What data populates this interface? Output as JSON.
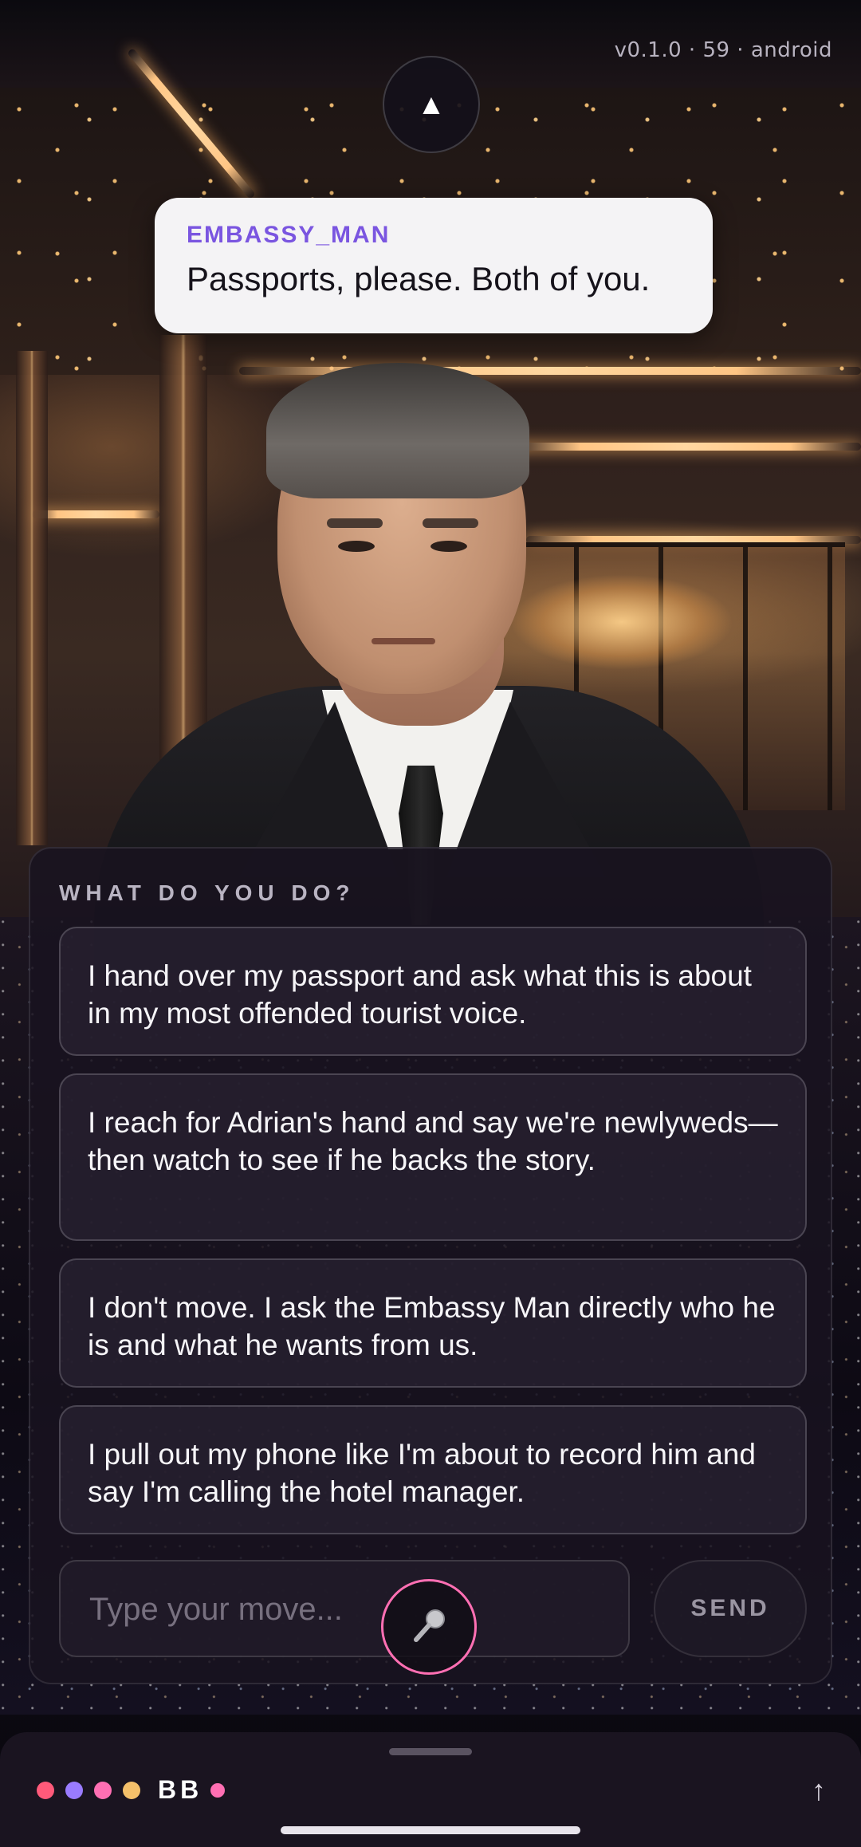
{
  "status": {
    "version": "v0.1.0 · 59 · android"
  },
  "collapse_button": {
    "glyph": "▲"
  },
  "dialogue": {
    "speaker": "EMBASSY_MAN",
    "line": "Passports, please. Both of you."
  },
  "choices_panel": {
    "prompt": "WHAT DO YOU DO?",
    "choices": [
      "I hand over my passport and ask what this is about in my most offended tourist voice.",
      "I reach for Adrian's hand and say we're newlyweds—then watch to see if he backs the story.",
      "I don't move. I ask the Embassy Man directly who he is and what he wants from us.",
      "I pull out my phone like I'm about to record him and say I'm calling the hotel manager."
    ],
    "input": {
      "placeholder": "Type your move...",
      "value": ""
    },
    "send_label": "SEND",
    "mic_icon": "microphone-icon"
  },
  "dock": {
    "title": "BB",
    "up_glyph": "↑",
    "dots": [
      "#ff5a7a",
      "#9a7cff",
      "#ff6fb3",
      "#f4c06a",
      "#ff6fb3"
    ]
  },
  "colors": {
    "accent_purple": "#7a55e0",
    "mic_ring": "#ff6fb3"
  }
}
